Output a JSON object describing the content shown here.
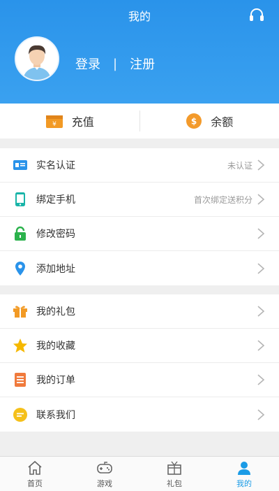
{
  "header": {
    "title": "我的"
  },
  "auth": {
    "login": "登录",
    "separator": "|",
    "register": "注册"
  },
  "wallet": {
    "recharge": "充值",
    "balance": "余额"
  },
  "account_items": [
    {
      "label": "实名认证",
      "note": "未认证"
    },
    {
      "label": "绑定手机",
      "note": "首次绑定送积分"
    },
    {
      "label": "修改密码",
      "note": ""
    },
    {
      "label": "添加地址",
      "note": ""
    }
  ],
  "personal_items": [
    {
      "label": "我的礼包"
    },
    {
      "label": "我的收藏"
    },
    {
      "label": "我的订单"
    },
    {
      "label": "联系我们"
    }
  ],
  "tabs": [
    {
      "label": "首页",
      "icon": "home-icon"
    },
    {
      "label": "游戏",
      "icon": "gamepad-icon"
    },
    {
      "label": "礼包",
      "icon": "gift-box-icon"
    },
    {
      "label": "我的",
      "icon": "user-icon",
      "active": true
    }
  ],
  "colors": {
    "accent": "#1a9be6",
    "header": "#2a93ea",
    "recharge": "#f29a25",
    "balance": "#f39a2b"
  }
}
